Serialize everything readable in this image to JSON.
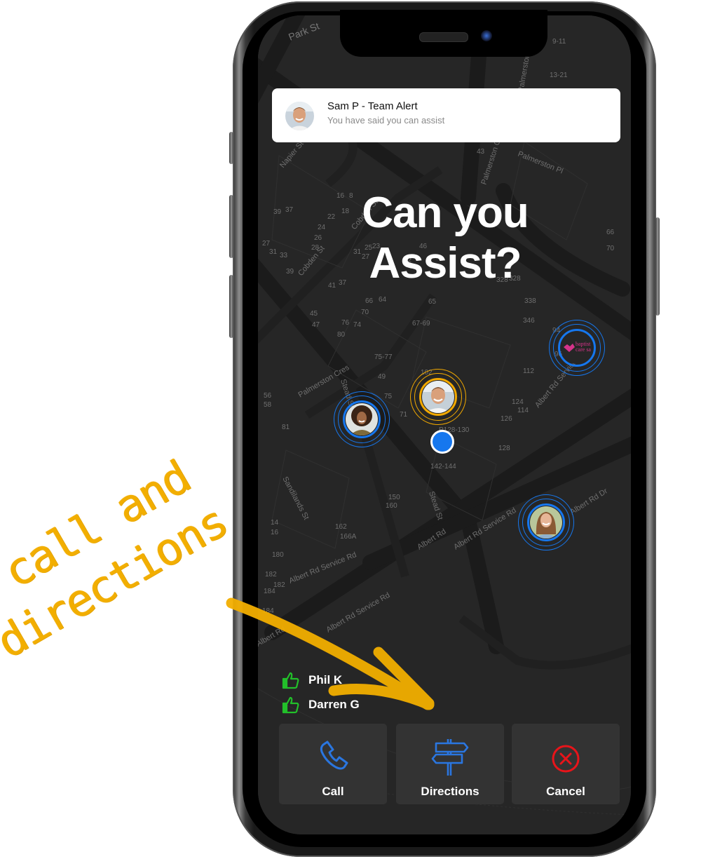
{
  "notification": {
    "sender": "Sam P  - Team Alert",
    "message": "You have said you can assist",
    "avatar_icon": "person-avatar-sam"
  },
  "headline": {
    "line1": "Can you",
    "line2": "Assist?"
  },
  "map": {
    "street_labels": [
      "Park St",
      "Napier St",
      "Cobden St",
      "Palmerston Cres",
      "Palmerston Pl",
      "Stead St",
      "Sandilands St",
      "Albert Rd",
      "Albert Rd Service Rd",
      "Albert Rd Dr"
    ],
    "markers": [
      {
        "name": "Sam P",
        "ring_color": "#f2a900",
        "type": "person"
      },
      {
        "name": "team-member-woman-curly",
        "ring_color": "#1677ee",
        "type": "person"
      },
      {
        "name": "team-member-woman",
        "ring_color": "#1677ee",
        "type": "person"
      },
      {
        "name": "baptist care sa",
        "ring_color": "#1677ee",
        "type": "organisation"
      }
    ],
    "org_logo_text": [
      "baptist",
      "care sa"
    ],
    "my_location_color": "#1677ee"
  },
  "helpers": [
    {
      "name": "Phil K",
      "icon": "thumbs-up-icon"
    },
    {
      "name": "Darren G",
      "icon": "thumbs-up-icon"
    }
  ],
  "actions": [
    {
      "label": "Call",
      "icon": "phone-icon",
      "color": "#2a76e0"
    },
    {
      "label": "Directions",
      "icon": "signpost-icon",
      "color": "#2a76e0"
    },
    {
      "label": "Cancel",
      "icon": "cancel-circle-icon",
      "color": "#e8141a"
    }
  ],
  "annotation": {
    "line1": "call and",
    "line2": "directions",
    "color": "#f2ae00"
  },
  "colors": {
    "screen_bg": "#262626",
    "button_bg": "#333333",
    "accent_blue": "#1677ee",
    "accent_orange": "#f2a900",
    "thumbs_green": "#22c02a"
  }
}
